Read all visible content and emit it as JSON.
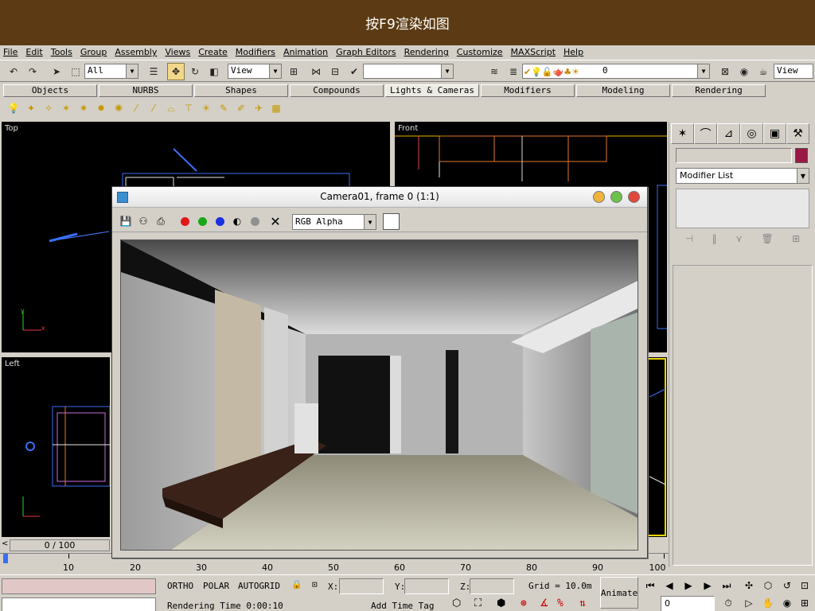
{
  "banner": {
    "text": "按F9渲染如图"
  },
  "menu": [
    "File",
    "Edit",
    "Tools",
    "Group",
    "Assembly",
    "Views",
    "Create",
    "Modifiers",
    "Animation",
    "Graph Editors",
    "Rendering",
    "Customize",
    "MAXScript",
    "Help"
  ],
  "toolbar": {
    "selection_filter": "All",
    "ref_coord": "View",
    "named_selection": "",
    "layer": "0",
    "view_combo": "View"
  },
  "tabs": [
    "Objects",
    "NURBS",
    "Shapes",
    "Compounds",
    "Lights & Cameras",
    "Modifiers",
    "Modeling",
    "Rendering"
  ],
  "selected_tab": "Lights & Cameras",
  "viewports": {
    "top": "Top",
    "front": "Front",
    "left": "Left"
  },
  "command_panel": {
    "modifier_list": "Modifier List",
    "object_color": "#9a1846"
  },
  "time": {
    "slider": "0 / 100",
    "ruler_ticks": [
      "10",
      "20",
      "30",
      "40",
      "50",
      "60",
      "70",
      "80",
      "90",
      "100"
    ]
  },
  "status": {
    "ortho": "ORTHO",
    "polar": "POLAR",
    "autogrid": "AUTOGRID",
    "x_label": "X:",
    "y_label": "Y:",
    "z_label": "Z:",
    "grid": "Grid = 10.0m",
    "animate": "Animate",
    "rendering_time": "Rendering Time  0:00:10",
    "add_time_tag": "Add Time Tag",
    "frame": "0"
  },
  "render_window": {
    "title": "Camera01, frame 0 (1:1)",
    "channel": "RGB Alpha"
  }
}
